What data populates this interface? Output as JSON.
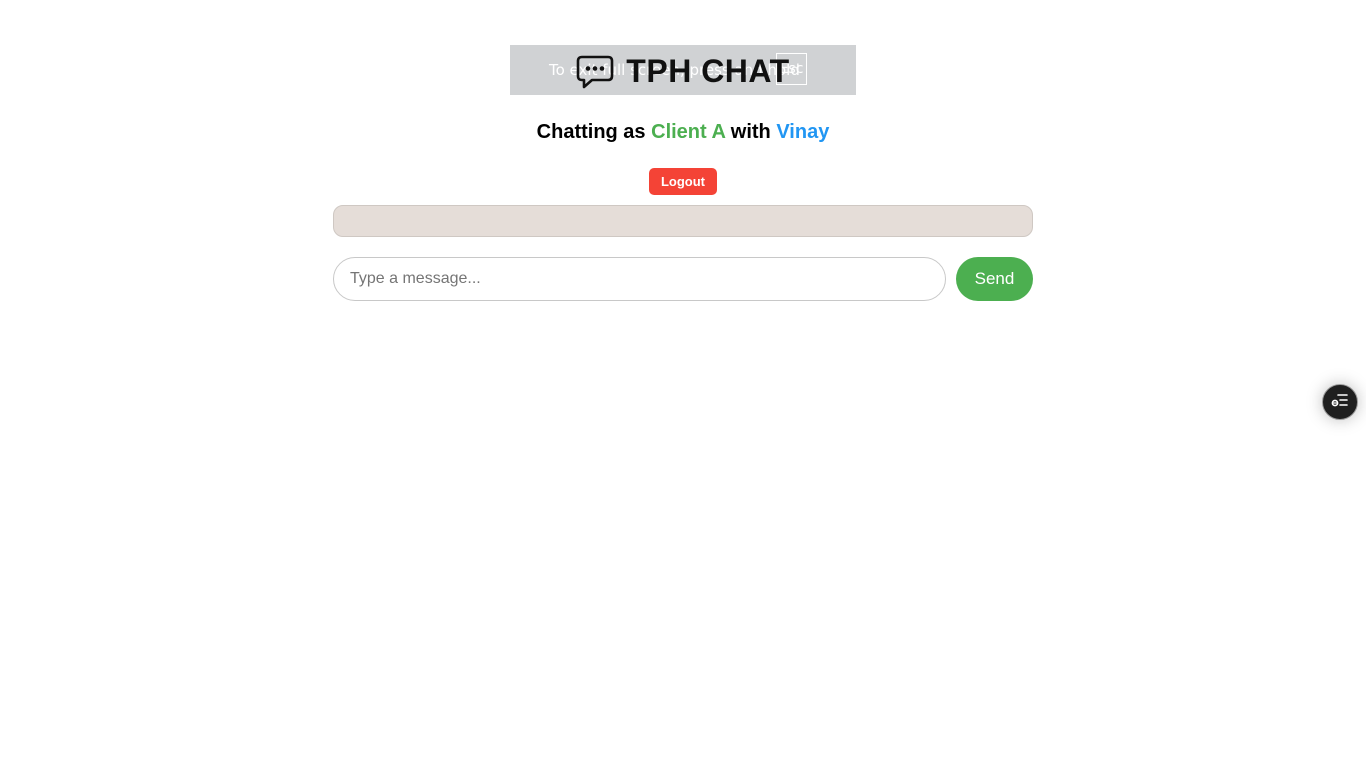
{
  "fullscreen_notice": {
    "text": "To exit full screen, press and hold",
    "key": "Esc"
  },
  "header": {
    "app_icon": "chat-bubble-dots-icon",
    "title": "TPH CHAT"
  },
  "session": {
    "prefix": "Chatting as",
    "client_name": "Client A",
    "connector": "with",
    "partner_name": "Vinay",
    "client_color": "#4caf50",
    "partner_color": "#2196f3"
  },
  "actions": {
    "logout_label": "Logout"
  },
  "composer": {
    "placeholder": "Type a message...",
    "value": "",
    "send_label": "Send"
  },
  "messages": [],
  "floating_widget": {
    "icon": "toggle-list-icon"
  },
  "colors": {
    "logout": "#f44336",
    "send": "#4caf50",
    "messages_bg": "#e5ddd8"
  }
}
